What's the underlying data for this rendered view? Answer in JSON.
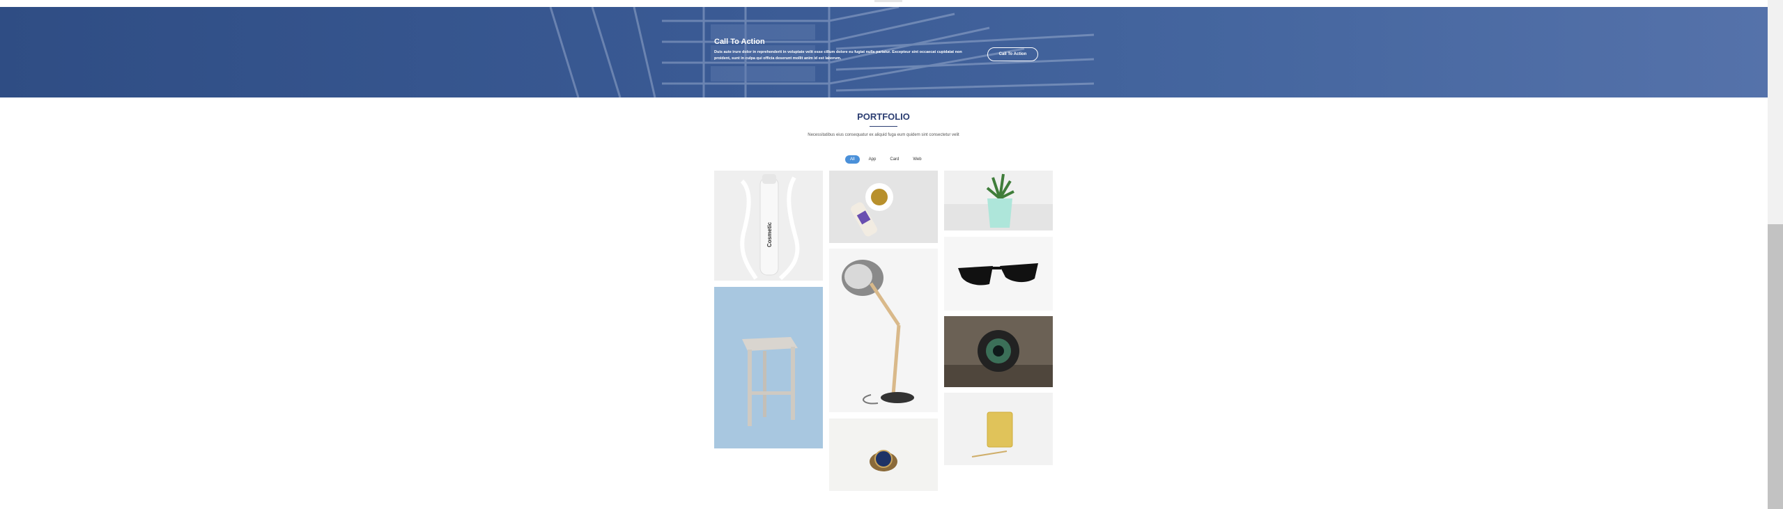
{
  "cta": {
    "title": "Call To Action",
    "text": "Duis aute irure dolor in reprehenderit in voluptate velit esse cillum dolore eu fugiat nulla pariatur. Excepteur sint occaecat cupidatat non proident, sunt in culpa qui officia deserunt mollit anim id est laborum.",
    "button_label": "Call To Action",
    "background_color": "#3a5a94"
  },
  "portfolio": {
    "title": "PORTFOLIO",
    "subtitle": "Necessitatibus eius consequatur ex aliquid fuga eum quidem sint consectetur velit",
    "filters": [
      {
        "label": "All",
        "active": true
      },
      {
        "label": "App",
        "active": false
      },
      {
        "label": "Card",
        "active": false
      },
      {
        "label": "Web",
        "active": false
      }
    ],
    "items": [
      {
        "name": "portfolio-item-cosmetic-bottle",
        "depicts": "white cosmetic bottle with splash",
        "text": "Cosmetic"
      },
      {
        "name": "portfolio-item-stool",
        "depicts": "wooden stool on blue background"
      },
      {
        "name": "portfolio-item-coffee-can",
        "depicts": "coffee cup and can"
      },
      {
        "name": "portfolio-item-desk-lamp",
        "depicts": "adjustable desk lamp"
      },
      {
        "name": "portfolio-item-watch",
        "depicts": "wrist watch"
      },
      {
        "name": "portfolio-item-plant",
        "depicts": "succulent in mint pot"
      },
      {
        "name": "portfolio-item-sunglasses",
        "depicts": "black sunglasses"
      },
      {
        "name": "portfolio-item-camera-lens",
        "depicts": "camera lens"
      },
      {
        "name": "portfolio-item-glass",
        "depicts": "glass of drink"
      }
    ]
  },
  "colors": {
    "accent": "#4a90d9",
    "heading": "#2c3e72"
  }
}
